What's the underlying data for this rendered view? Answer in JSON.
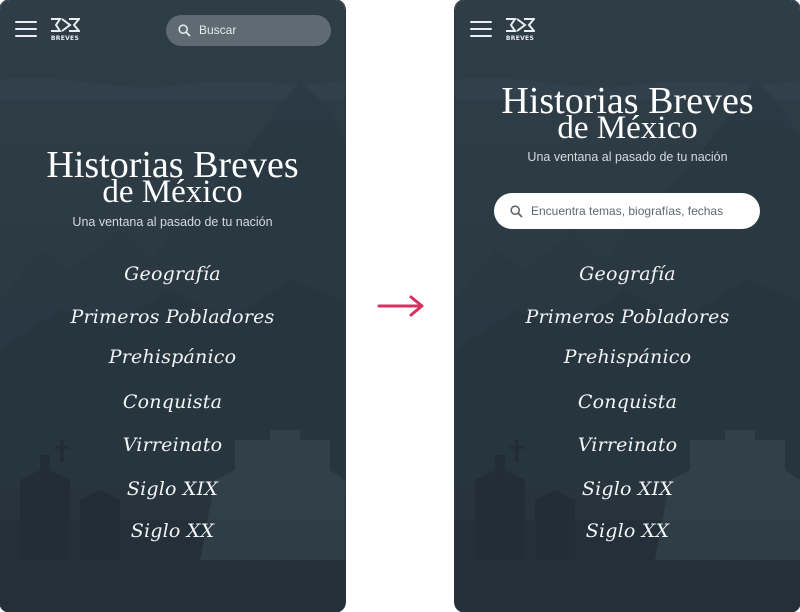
{
  "screens": [
    {
      "brand": "BREVES",
      "search_label": "Buscar",
      "title_line1": "Historias Breves",
      "title_line2": "de México",
      "subtitle": "Una ventana al pasado de tu nación",
      "nav": [
        "Geografía",
        "Primeros Pobladores",
        "Prehispánico",
        "Conquista",
        "Virreinato",
        "Siglo XIX",
        "Siglo XX"
      ]
    },
    {
      "brand": "BREVES",
      "title_line1": "Historias Breves",
      "title_line2": "de México",
      "subtitle": "Una ventana al pasado de tu nación",
      "search_placeholder": "Encuentra temas, biografías, fechas",
      "nav": [
        "Geografía",
        "Primeros Pobladores",
        "Prehispánico",
        "Conquista",
        "Virreinato",
        "Siglo XIX",
        "Siglo XX"
      ]
    }
  ],
  "colors": {
    "background": "#2c3a44",
    "arrow": "#d8305f",
    "text": "#ffffff"
  },
  "icons": [
    "menu-icon",
    "brand-logo-icon",
    "search-icon",
    "arrow-right-icon"
  ]
}
